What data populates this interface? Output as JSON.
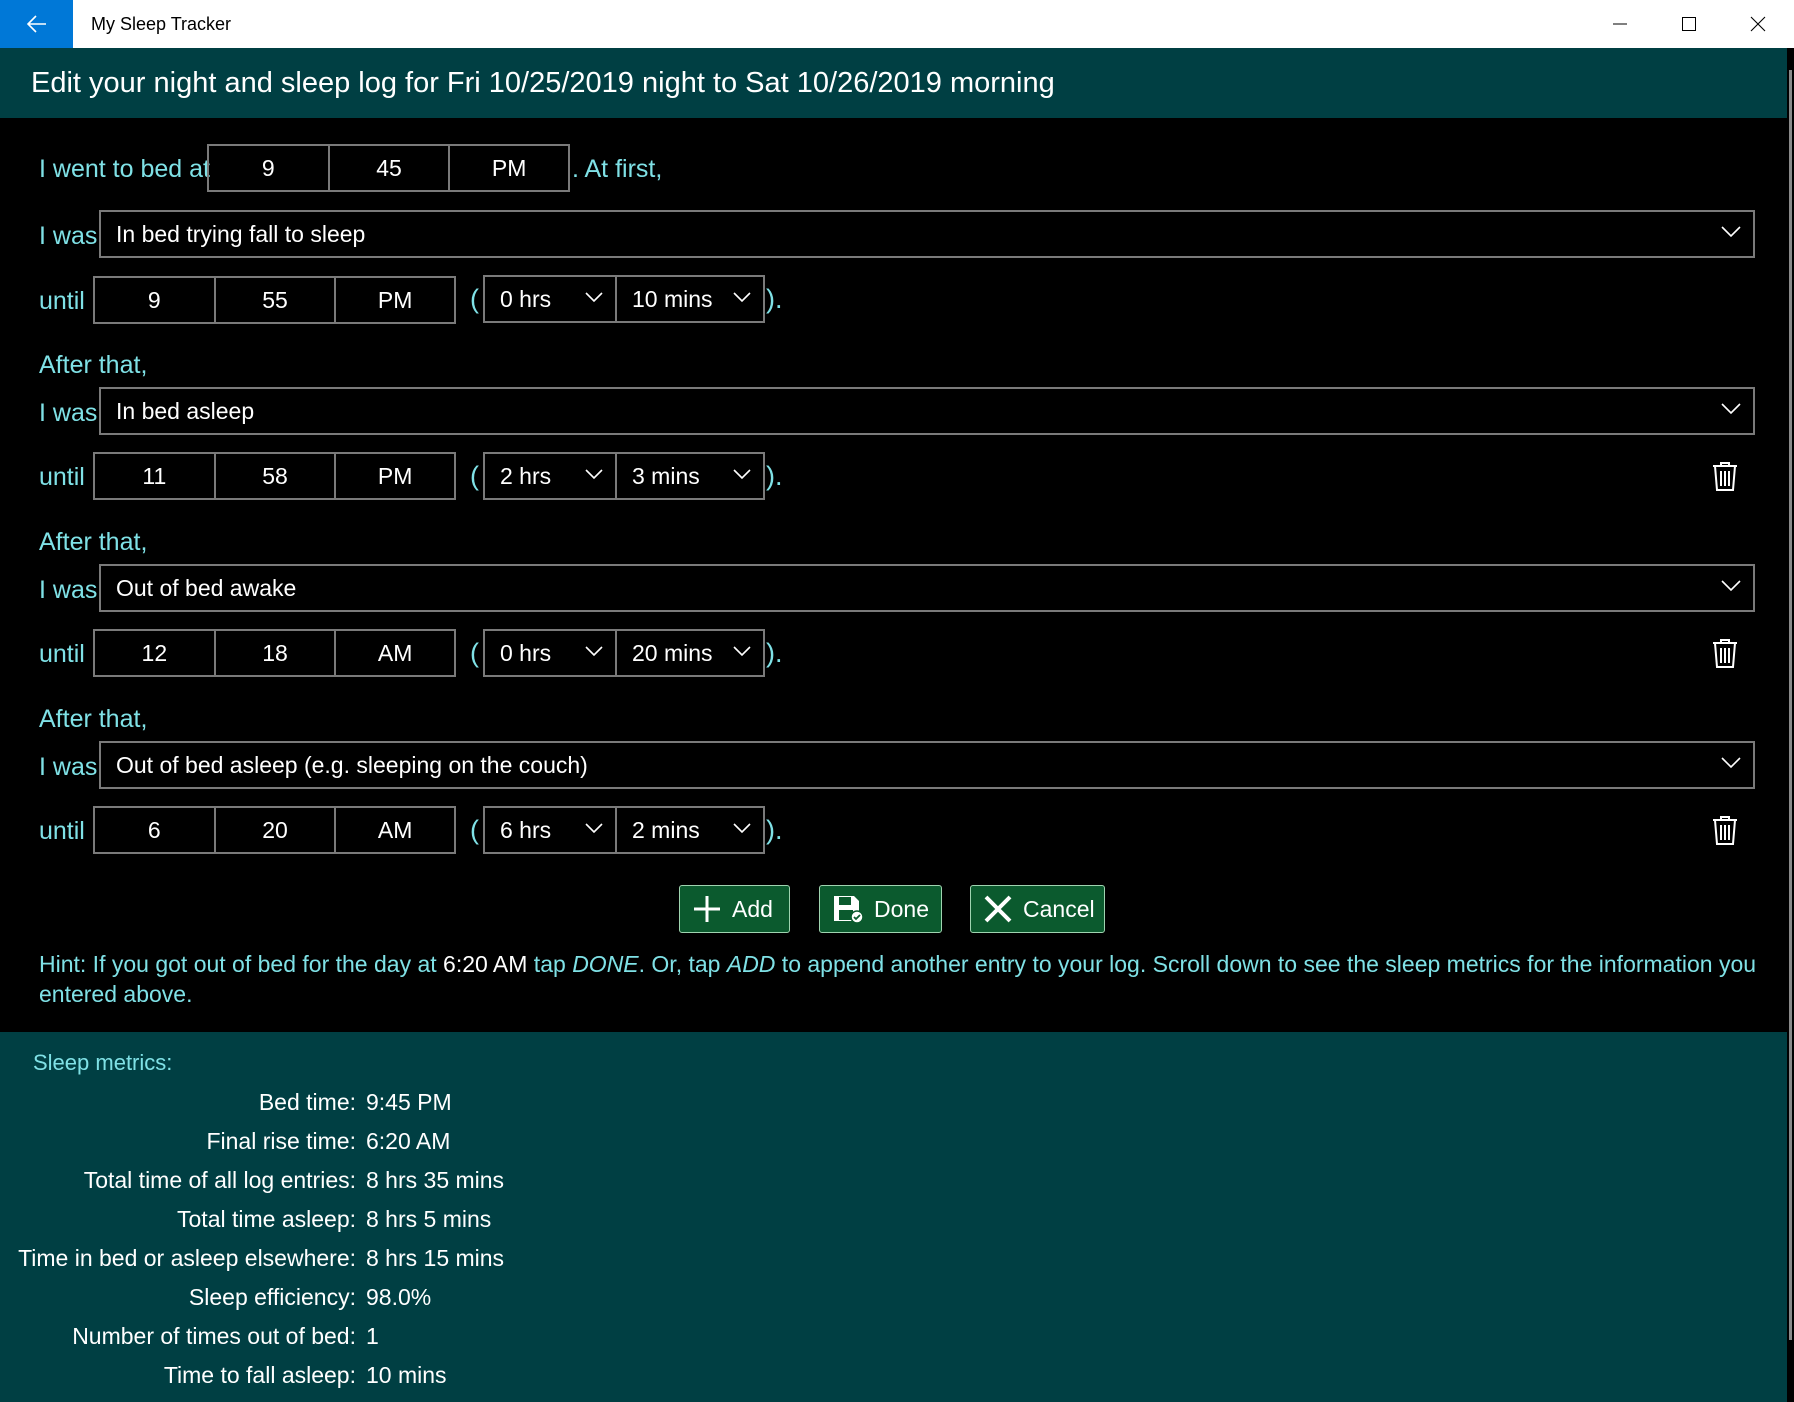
{
  "titlebar": {
    "app_title": "My Sleep Tracker"
  },
  "header": {
    "title": "Edit your night and sleep log for Fri 10/25/2019 night to Sat 10/26/2019 morning"
  },
  "bedtime": {
    "label": "I went to bed at",
    "hour": "9",
    "minute": "45",
    "ampm": "PM",
    "suffix": ". At first,"
  },
  "labels": {
    "i_was": "I was",
    "until": "until",
    "after_that": "After that,",
    "paren_open": "(",
    "paren_close": ")."
  },
  "entries": [
    {
      "state": "In bed trying fall to sleep",
      "hour": "9",
      "minute": "55",
      "ampm": "PM",
      "hrs": "0 hrs",
      "mins": "10 mins"
    },
    {
      "state": "In bed asleep",
      "hour": "11",
      "minute": "58",
      "ampm": "PM",
      "hrs": "2 hrs",
      "mins": "3 mins"
    },
    {
      "state": "Out of bed awake",
      "hour": "12",
      "minute": "18",
      "ampm": "AM",
      "hrs": "0 hrs",
      "mins": "20 mins"
    },
    {
      "state": "Out of bed asleep (e.g. sleeping on the couch)",
      "hour": "6",
      "minute": "20",
      "ampm": "AM",
      "hrs": "6 hrs",
      "mins": "2 mins"
    }
  ],
  "buttons": {
    "add": "Add",
    "done": "Done",
    "cancel": "Cancel"
  },
  "hint": {
    "p1": "Hint: If you got out of bed for the day at ",
    "time": "6:20 AM",
    "p2": " tap ",
    "done": "DONE",
    "p3": ". Or, tap ",
    "add": "ADD",
    "p4": " to append another entry to your log. Scroll down to see the sleep metrics for the information you entered above."
  },
  "metrics": {
    "title": "Sleep metrics:",
    "rows": [
      {
        "label": "Bed time:",
        "value": "9:45 PM"
      },
      {
        "label": "Final rise time:",
        "value": "6:20 AM"
      },
      {
        "label": "Total time of all log entries:",
        "value": "8 hrs 35 mins"
      },
      {
        "label": "Total time asleep:",
        "value": "8 hrs 5 mins"
      },
      {
        "label": "Time in bed or asleep elsewhere:",
        "value": "8 hrs 15 mins"
      },
      {
        "label": "Sleep efficiency:",
        "value": "98.0%"
      },
      {
        "label": "Number of times out of bed:",
        "value": "1"
      },
      {
        "label": "Time to fall asleep:",
        "value": "10 mins"
      }
    ]
  },
  "colors": {
    "accent": "#0078d7",
    "header_bg": "#003f43",
    "label": "#7fe1e6",
    "button_bg": "#0b5a2e"
  },
  "icons": [
    "back-arrow-icon",
    "minimize-icon",
    "maximize-icon",
    "close-icon",
    "chevron-down-icon",
    "trash-icon",
    "plus-icon",
    "save-icon",
    "x-icon"
  ]
}
